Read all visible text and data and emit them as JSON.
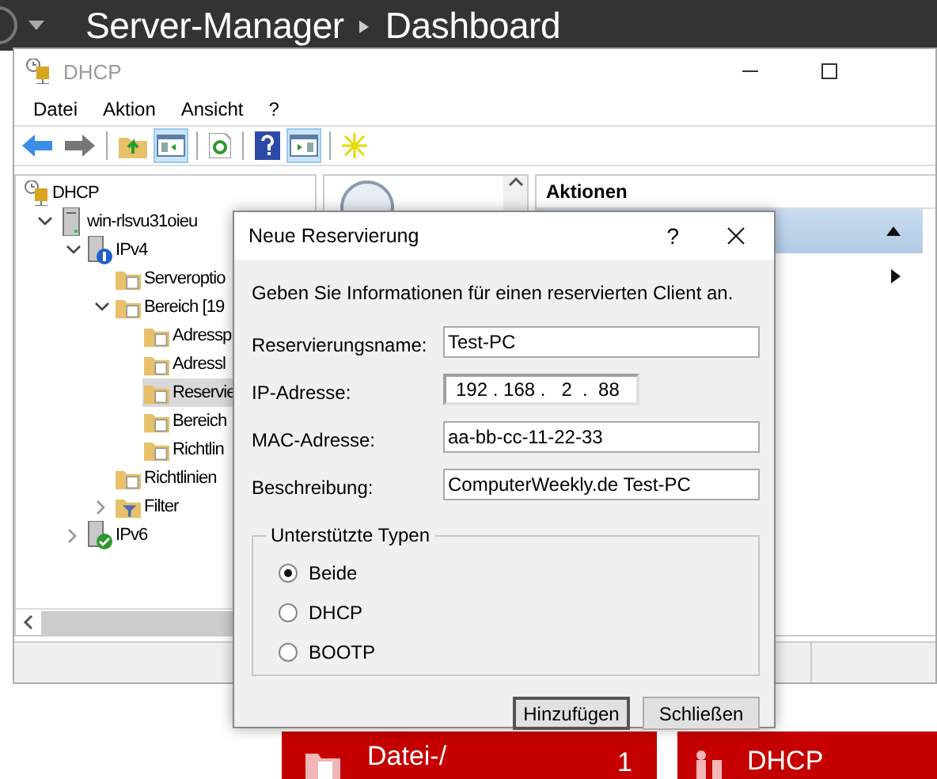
{
  "server_manager": {
    "title": "Server-Manager",
    "page": "Dashboard",
    "tiles": [
      {
        "kind": "files",
        "label": "Datei-/",
        "count": "1"
      },
      {
        "kind": "tool",
        "label": "DHCP"
      }
    ]
  },
  "mmc": {
    "title": "DHCP",
    "menu": [
      "Datei",
      "Aktion",
      "Ansicht",
      "?"
    ],
    "toolbar": [
      {
        "kind": "back",
        "on": false
      },
      {
        "kind": "forward",
        "on": false
      },
      {
        "kind": "separator"
      },
      {
        "kind": "up",
        "on": false
      },
      {
        "kind": "tree",
        "on": true
      },
      {
        "kind": "separator"
      },
      {
        "kind": "refresh",
        "on": false
      },
      {
        "kind": "separator"
      },
      {
        "kind": "help",
        "on": false
      },
      {
        "kind": "actions",
        "on": true
      },
      {
        "kind": "separator"
      },
      {
        "kind": "new",
        "on": false
      }
    ],
    "tree": [
      {
        "label": "DHCP",
        "kind": "root",
        "selected": false,
        "children": [
          {
            "label": "win-rlsvu31oieu",
            "kind": "server",
            "expanded": true,
            "selected": false,
            "children": [
              {
                "label": "IPv4",
                "kind": "ipv4",
                "expanded": true,
                "selected": false,
                "children": [
                  {
                    "label": "Serveroptio",
                    "kind": "folder",
                    "selected": false
                  },
                  {
                    "label": "Bereich [19",
                    "kind": "folder",
                    "expanded": true,
                    "selected": false,
                    "children": [
                      {
                        "label": "Adressp",
                        "kind": "folder",
                        "selected": false
                      },
                      {
                        "label": "Adressl",
                        "kind": "folder",
                        "selected": false
                      },
                      {
                        "label": "Reservie",
                        "kind": "folder",
                        "selected": true
                      },
                      {
                        "label": "Bereich",
                        "kind": "folder",
                        "selected": false
                      },
                      {
                        "label": "Richtlin",
                        "kind": "folder",
                        "selected": false
                      }
                    ]
                  },
                  {
                    "label": "Richtlinien",
                    "kind": "folder",
                    "selected": false
                  },
                  {
                    "label": "Filter",
                    "kind": "filter",
                    "expanded": false,
                    "selected": false
                  }
                ]
              },
              {
                "label": "IPv6",
                "kind": "ipv6",
                "expanded": false,
                "selected": false
              }
            ]
          }
        ]
      }
    ],
    "actions": {
      "title": "Aktionen",
      "rows": [
        {
          "kind": "group",
          "selected": true
        },
        {
          "kind": "submenu",
          "selected": false
        }
      ]
    }
  },
  "dialog": {
    "title": "Neue Reservierung",
    "help": "?",
    "intro": "Geben Sie Informationen für einen reservierten Client an.",
    "fields": [
      {
        "label": "Reservierungsname:",
        "value": "Test-PC",
        "kind": "text"
      },
      {
        "label": "IP-Adresse:",
        "value": "192 . 168 .   2  .  88",
        "kind": "ip"
      },
      {
        "label": "MAC-Adresse:",
        "value": "aa-bb-cc-11-22-33",
        "kind": "text"
      },
      {
        "label": "Beschreibung:",
        "value": "ComputerWeekly.de Test-PC",
        "kind": "text"
      }
    ],
    "types": {
      "legend": "Unterstützte Typen",
      "options": [
        {
          "label": "Beide",
          "selected": true
        },
        {
          "label": "DHCP",
          "selected": false
        },
        {
          "label": "BOOTP",
          "selected": false
        }
      ]
    },
    "buttons": [
      {
        "label": "Hinzufügen",
        "default": true
      },
      {
        "label": "Schließen",
        "default": false
      }
    ]
  }
}
